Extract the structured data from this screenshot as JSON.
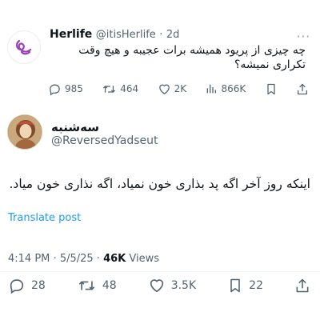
{
  "parent_tweet": {
    "name": "Herlife",
    "handle": "@itisHerlife",
    "separator": "·",
    "time": "2d",
    "text": "چه چیزی از پریود همیشه برات عجیبه و هیچ وقت تکراری نمیشه؟",
    "actions": {
      "replies": "985",
      "reposts": "464",
      "likes": "2K",
      "views": "866K"
    },
    "icons": [
      "logo-icon",
      "more-icon",
      "reply-icon",
      "repost-icon",
      "like-icon",
      "views-icon",
      "bookmark-icon",
      "share-icon"
    ]
  },
  "tweet": {
    "name": "سه‌شنبه",
    "handle": "@ReversedYadseut",
    "text": "اینکه روز آخر اگه پد بذاری خون نمیاد، اگه نذاری خون میاد.",
    "translate_label": "Translate post",
    "time": "4:14 PM",
    "date": "5/5/25",
    "dot": "·",
    "views_count": "46K",
    "views_label": "Views",
    "actions": {
      "replies": "28",
      "reposts": "48",
      "likes": "3.5K",
      "bookmarks": "22"
    }
  },
  "colors": {
    "text": "#0f1419",
    "secondary": "#536471",
    "link": "#1d9bf0",
    "logo": "#9a3fb8"
  }
}
